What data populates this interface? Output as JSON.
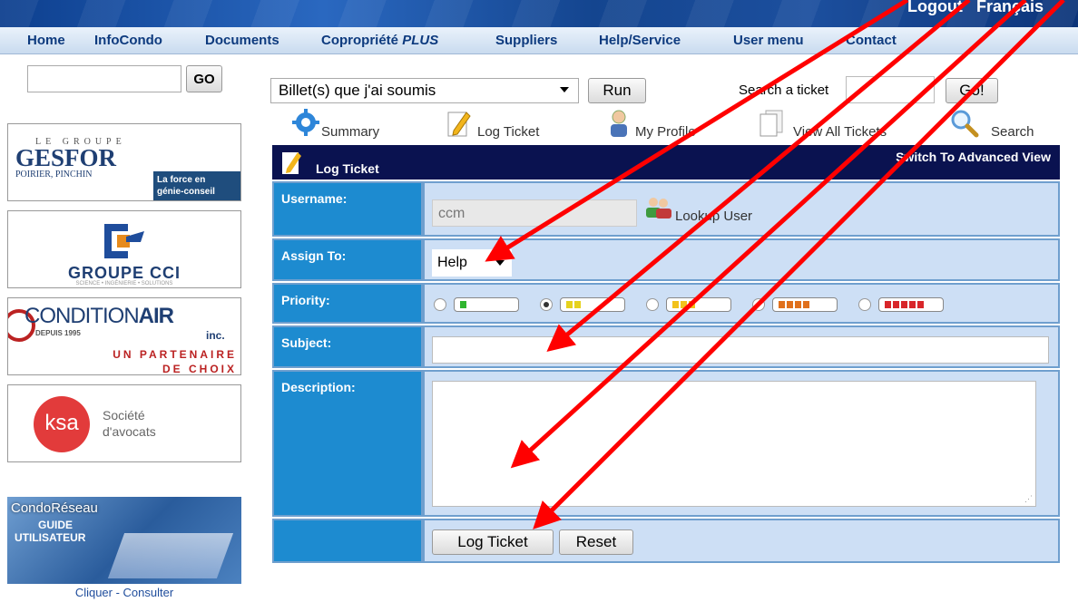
{
  "banner": {
    "logout": "Logout",
    "language": "Français"
  },
  "nav": {
    "items": [
      {
        "label": "Home"
      },
      {
        "label": "InfoCondo"
      },
      {
        "label": "Documents"
      },
      {
        "label": "Copropriété",
        "suffix": "PLUS"
      },
      {
        "label": "Suppliers"
      },
      {
        "label": "Help/Service"
      },
      {
        "label": "User menu"
      },
      {
        "label": "Contact"
      }
    ]
  },
  "sidebar": {
    "search_button": "GO",
    "ads": {
      "gesfor": {
        "tagline": "LE GROUPE",
        "name": "GESFOR",
        "sub": "POIRIER, PINCHIN",
        "badge1": "La force en",
        "badge2": "génie-conseil"
      },
      "cci": {
        "name": "GROUPE CCI",
        "sub": "SCIENCE • INGÉNIERIE • SOLUTIONS"
      },
      "conditionair": {
        "name_a": "CONDITION",
        "name_b": "AIR",
        "inc": "inc.",
        "since": "DEPUIS 1995",
        "partner1": "UN PARTENAIRE",
        "partner2": "DE CHOIX"
      },
      "ksa": {
        "logo": "ksa",
        "line1": "Société",
        "line2": "d'avocats"
      },
      "condo": {
        "title": "CondoRéseau",
        "line1": "GUIDE",
        "line2": "UTILISATEUR",
        "cta": "Cliquer - Consulter"
      }
    }
  },
  "toolbar": {
    "filter_value": "Billet(s) que j'ai soumis",
    "run_label": "Run",
    "search_label": "Search a ticket",
    "go_label": "Go!",
    "tools": [
      {
        "label": "Summary",
        "icon": "gear-icon"
      },
      {
        "label": "Log Ticket",
        "icon": "pencil-note-icon"
      },
      {
        "label": "My Profile",
        "icon": "person-icon"
      },
      {
        "label": "View All Tickets",
        "icon": "documents-icon"
      },
      {
        "label": "Search",
        "icon": "magnifier-icon"
      }
    ]
  },
  "form": {
    "title": "Log Ticket",
    "advanced_link": "Switch To Advanced View",
    "username_label": "Username:",
    "username_value": "ccm",
    "lookup_label": "Lookup User",
    "assign_label": "Assign To:",
    "assign_value": "Help",
    "priority_label": "Priority:",
    "priority_selected_index": 1,
    "priorities": [
      {
        "bars": 1,
        "color": "#2fb52f"
      },
      {
        "bars": 2,
        "color": "#e6d21c"
      },
      {
        "bars": 3,
        "color": "#f2c21c"
      },
      {
        "bars": 4,
        "color": "#e0701c"
      },
      {
        "bars": 5,
        "color": "#d8262a"
      }
    ],
    "subject_label": "Subject:",
    "description_label": "Description:",
    "submit_label": "Log Ticket",
    "reset_label": "Reset"
  },
  "colors": {
    "arrow": "#ff0000",
    "header": "#0a1250",
    "label_bg": "#1d8bd0",
    "cell_bg": "#cddff5"
  }
}
